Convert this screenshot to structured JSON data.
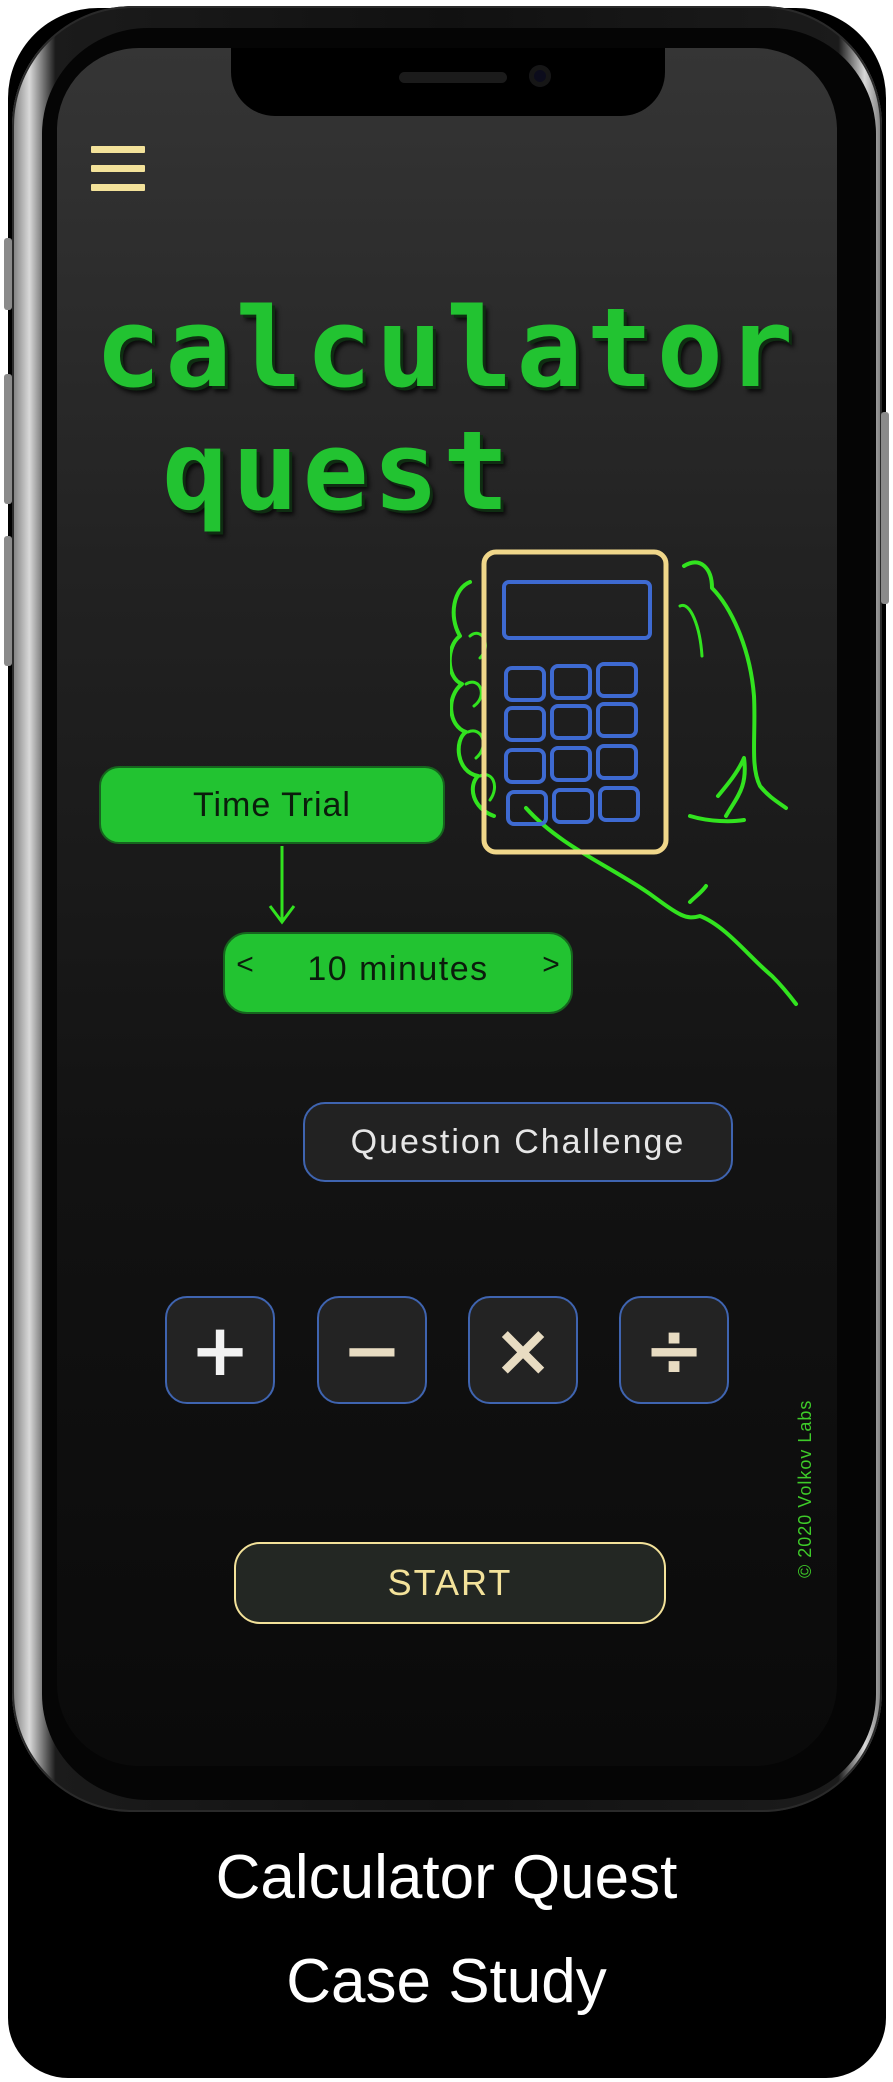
{
  "app": {
    "logo_line_1": "calculator",
    "logo_line_2": "quest",
    "menu_icon": "hamburger-icon"
  },
  "modes": {
    "time_trial": "Time Trial",
    "duration": {
      "value": "10 minutes",
      "prev": "<",
      "next": ">"
    },
    "question_challenge": "Question Challenge"
  },
  "operations": [
    {
      "symbol": "+",
      "icon": "plus-icon"
    },
    {
      "symbol": "−",
      "icon": "minus-icon"
    },
    {
      "symbol": "×",
      "icon": "multiply-icon"
    },
    {
      "symbol": "÷",
      "icon": "divide-icon"
    }
  ],
  "start_label": "START",
  "copyright": "© 2020 Volkov Labs",
  "caption": {
    "line1": "Calculator Quest",
    "line2": "Case Study"
  },
  "colors": {
    "accent_green": "#22c331",
    "menu_yellow": "#f3e29a",
    "outline_blue": "#3f64b0",
    "op_glyph": "#e8dcc2"
  }
}
